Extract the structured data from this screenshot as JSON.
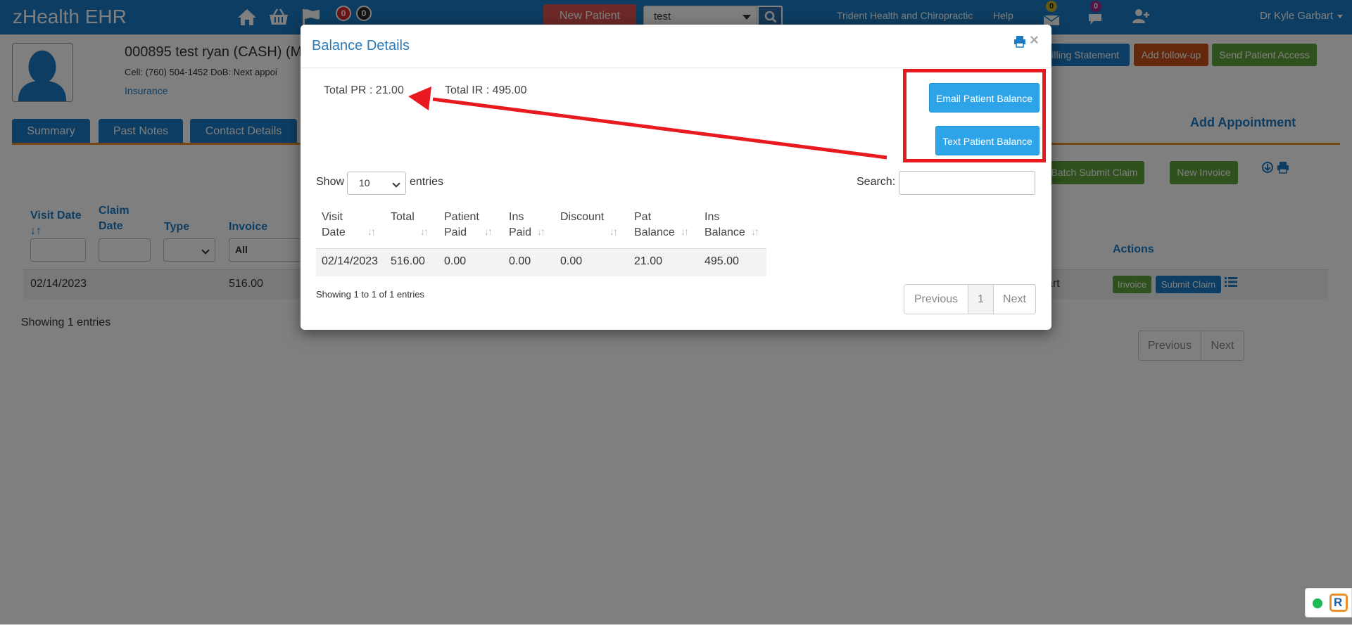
{
  "app": {
    "brand": "zHealth EHR",
    "badges": [
      "0",
      "0"
    ],
    "new_patient_label": "New Patient",
    "search_value": "test",
    "practice": "Trident Health and Chiropractic",
    "help": "Help",
    "message_badges": [
      "0",
      "0"
    ],
    "user": "Dr Kyle Garbart"
  },
  "patient": {
    "name": "000895 test ryan  (CASH) (M",
    "info": "Cell: (760) 504-1452   DoB:     Next appoi",
    "insurance_link": "Insurance"
  },
  "header_buttons": {
    "billing_statement": "Billing Statement",
    "add_follow_up": "Add follow-up",
    "send_patient_access": "Send Patient Access"
  },
  "tabs": [
    "Summary",
    "Past Notes",
    "Contact Details"
  ],
  "add_appointment": "Add Appointment",
  "invoice_toolbar": {
    "batch_submit_claim": "Batch Submit Claim",
    "new_invoice": "New Invoice"
  },
  "background_table": {
    "headers": {
      "visit_date": "Visit Date",
      "visit_date_sort": "↓↑",
      "claim_date_1": "Claim",
      "claim_date_2": "Date",
      "type": "Type",
      "invoice": "Invoice",
      "actions": "Actions"
    },
    "invoice_filter": "All",
    "row": {
      "visit_date": "02/14/2023",
      "invoice": "516.00",
      "provider_fragment": "art",
      "invoice_button": "Invoice",
      "submit_claim_button": "Submit Claim"
    },
    "footer": "Showing 1 entries",
    "pager": {
      "previous": "Previous",
      "next": "Next"
    }
  },
  "modal": {
    "title": "Balance Details",
    "close": "×",
    "total_pr": "Total PR : 21.00",
    "total_ir": "Total IR : 495.00",
    "email_button": "Email Patient Balance",
    "text_button": "Text Patient Balance",
    "show_label": "Show",
    "entries_value": "10",
    "entries_label": "entries",
    "search_label": "Search:",
    "columns": [
      {
        "line1": "Visit",
        "line2": "Date"
      },
      {
        "line1": "Total",
        "line2": ""
      },
      {
        "line1": "Patient",
        "line2": "Paid"
      },
      {
        "line1": "Ins",
        "line2": "Paid"
      },
      {
        "line1": "Discount",
        "line2": ""
      },
      {
        "line1": "Pat",
        "line2": "Balance"
      },
      {
        "line1": "Ins",
        "line2": "Balance"
      }
    ],
    "rows": [
      [
        "02/14/2023",
        "516.00",
        "0.00",
        "0.00",
        "0.00",
        "21.00",
        "495.00"
      ]
    ],
    "footer": "Showing 1 to 1 of 1 entries",
    "pager": {
      "previous": "Previous",
      "page": "1",
      "next": "Next"
    }
  },
  "colors": {
    "nav_blue": "#1a7bc4",
    "accent_orange": "#e8912b",
    "annotation_red": "#e8191f",
    "button_blue": "#2ea4e8"
  }
}
